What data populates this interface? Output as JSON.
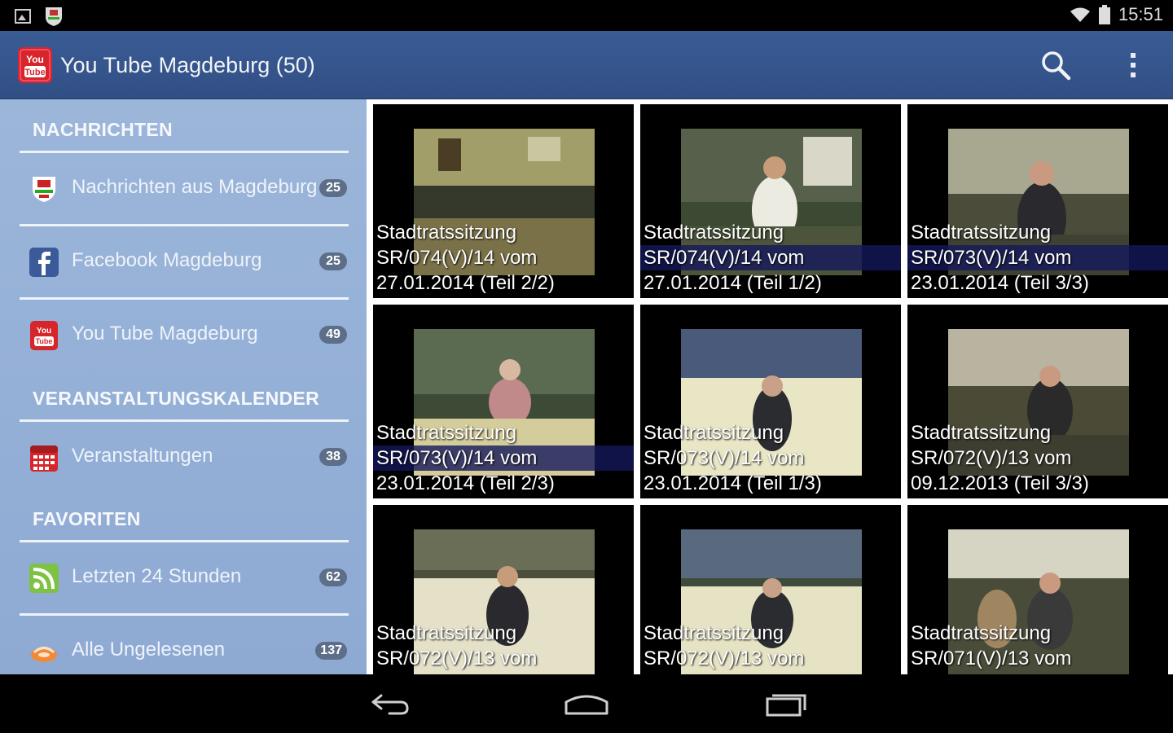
{
  "status_bar": {
    "time": "15:51",
    "icons": [
      "gallery-icon",
      "coat-of-arms-icon",
      "wifi-icon",
      "battery-icon"
    ]
  },
  "action_bar": {
    "title": "You Tube Magdeburg (50)",
    "icons": [
      "youtube-icon",
      "search-icon",
      "overflow-menu-icon"
    ]
  },
  "drawer": {
    "sections": [
      {
        "header": "NACHRICHTEN",
        "items": [
          {
            "label": "Nachrichten aus Magdeburg",
            "count": "25",
            "icon": "coat-of-arms-icon"
          },
          {
            "label": "Facebook Magdeburg",
            "count": "25",
            "icon": "facebook-icon"
          },
          {
            "label": "You Tube Magdeburg",
            "count": "49",
            "icon": "youtube-icon"
          }
        ]
      },
      {
        "header": "VERANSTALTUNGSKALENDER",
        "items": [
          {
            "label": "Veranstaltungen",
            "count": "38",
            "icon": "calendar-icon"
          }
        ]
      },
      {
        "header": "FAVORITEN",
        "items": [
          {
            "label": "Letzten 24 Stunden",
            "count": "62",
            "icon": "rss-icon"
          },
          {
            "label": "Alle Ungelesenen",
            "count": "137",
            "icon": "unread-icon"
          }
        ]
      }
    ]
  },
  "videos": [
    {
      "line1": "Stadtratssitzung",
      "line2": "SR/074(V)/14 vom",
      "line3": "27.01.2014 (Teil 2/2)"
    },
    {
      "line1": "Stadtratssitzung",
      "line2": "SR/074(V)/14 vom",
      "line3": "27.01.2014 (Teil 1/2)"
    },
    {
      "line1": "Stadtratssitzung",
      "line2": "SR/073(V)/14 vom",
      "line3": "23.01.2014 (Teil 3/3)"
    },
    {
      "line1": "Stadtratssitzung",
      "line2": "SR/073(V)/14 vom",
      "line3": "23.01.2014 (Teil 2/3)"
    },
    {
      "line1": "Stadtratssitzung",
      "line2": "SR/073(V)/14 vom",
      "line3": "23.01.2014 (Teil 1/3)"
    },
    {
      "line1": "Stadtratssitzung",
      "line2": "SR/072(V)/13 vom",
      "line3": "09.12.2013 (Teil 3/3)"
    },
    {
      "line1": "Stadtratssitzung",
      "line2": "SR/072(V)/13 vom",
      "line3": ""
    },
    {
      "line1": "Stadtratssitzung",
      "line2": "SR/072(V)/13 vom",
      "line3": ""
    },
    {
      "line1": "Stadtratssitzung",
      "line2": "SR/071(V)/13 vom",
      "line3": ""
    }
  ],
  "nav_bar": {
    "buttons": [
      "back-icon",
      "home-icon",
      "recents-icon"
    ]
  },
  "colors": {
    "action_bar": "#3a5c95",
    "drawer": "#9cb6da",
    "badge": "#5d6f88",
    "youtube_red": "#d7262b"
  }
}
